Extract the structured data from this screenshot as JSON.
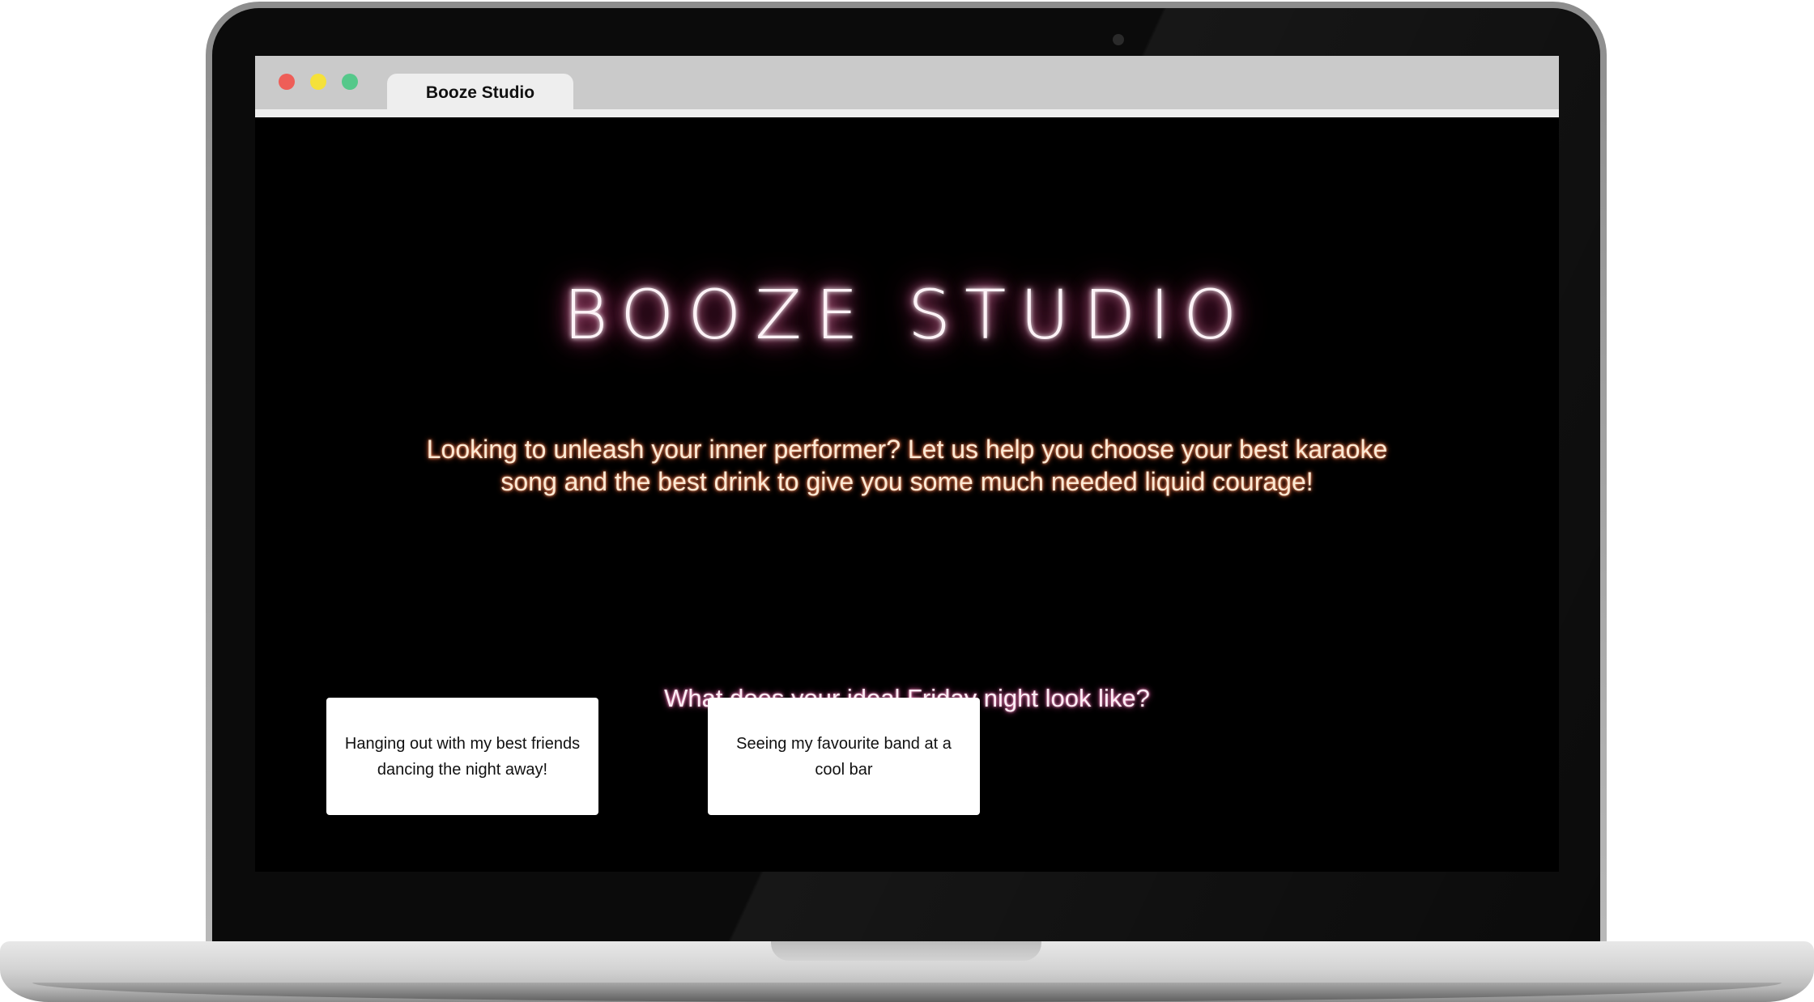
{
  "browser": {
    "tab_title": "Booze Studio",
    "window_controls": [
      "close",
      "minimize",
      "maximize"
    ]
  },
  "page": {
    "logo_text": "BOOZE STUDIO",
    "tagline": "Looking to unleash your inner performer? Let us help you choose your best karaoke song and the best drink to give you some much needed liquid courage!",
    "question": "What does your ideal Friday night look like?",
    "options": [
      {
        "label": "Hanging out with my best friends dancing the night away!"
      },
      {
        "label": "Seeing my favourite band at a cool bar"
      }
    ]
  },
  "colors": {
    "background": "#000000",
    "neon_pink": "#ff5fa8",
    "neon_orange": "#e0572e",
    "card": "#ffffff"
  }
}
